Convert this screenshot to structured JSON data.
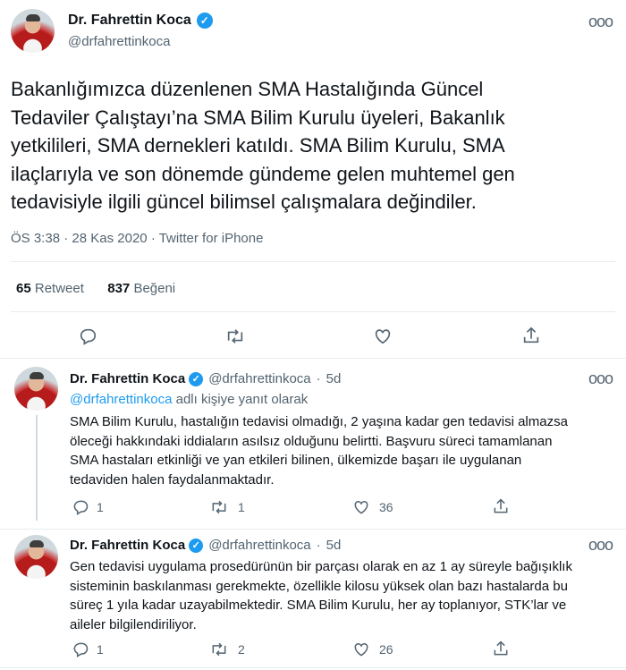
{
  "main_tweet": {
    "author_name": "Dr. Fahrettin Koca",
    "author_handle": "@drfahrettinkoca",
    "text_lines": [
      "Bakanlığımızca düzenlenen SMA Hastalığında Güncel",
      "Tedaviler Çalıştayı’na SMA Bilim Kurulu üyeleri, Bakanlık",
      "yetkilileri, SMA dernekleri katıldı. SMA Bilim Kurulu, SMA",
      "ilaçlarıyla ve son dönemde gündeme gelen muhtemel gen",
      "tedavisiyle ilgili güncel bilimsel çalışmalara değindiler."
    ],
    "time": "ÖS 3:38",
    "date": "28 Kas 2020",
    "source": "Twitter for iPhone",
    "retweet_count": "65",
    "retweet_label": "Retweet",
    "like_count": "837",
    "like_label": "Beğeni"
  },
  "replies": [
    {
      "author_name": "Dr. Fahrettin Koca",
      "author_handle": "@drfahrettinkoca",
      "age": "5d",
      "reply_to_handle": "@drfahrettinkoca",
      "reply_to_suffix": "adlı kişiye yanıt olarak",
      "text_lines": [
        "SMA Bilim Kurulu, hastalığın tedavisi olmadığı, 2 yaşına kadar gen tedavisi almazsa",
        "öleceği hakkındaki iddiaların asılsız olduğunu belirtti. Başvuru süreci tamamlanan",
        "SMA hastaları etkinliği ve yan etkileri bilinen, ülkemizde başarı ile uygulanan",
        "tedaviden halen faydalanmaktadır."
      ],
      "reply_count": "1",
      "retweet_count": "1",
      "like_count": "36"
    },
    {
      "author_name": "Dr. Fahrettin Koca",
      "author_handle": "@drfahrettinkoca",
      "age": "5d",
      "text_lines": [
        "Gen tedavisi uygulama prosedürünün bir parçası olarak en az 1 ay süreyle bağışıklık",
        "sisteminin baskılanması gerekmekte, özellikle kilosu yüksek olan bazı hastalarda bu",
        "süreç 1 yıla kadar uzayabilmektedir. SMA Bilim Kurulu, her ay toplanıyor, STK’lar ve",
        "aileler bilgilendiriliyor."
      ],
      "reply_count": "1",
      "retweet_count": "2",
      "like_count": "26"
    }
  ],
  "icons": {
    "more": "more-horizontal-icon",
    "verified": "verified-badge-icon",
    "reply": "reply-icon",
    "retweet": "retweet-icon",
    "like": "heart-icon",
    "share": "share-icon"
  },
  "colors": {
    "accent": "#1d9bf0",
    "secondary_text": "#536471"
  }
}
